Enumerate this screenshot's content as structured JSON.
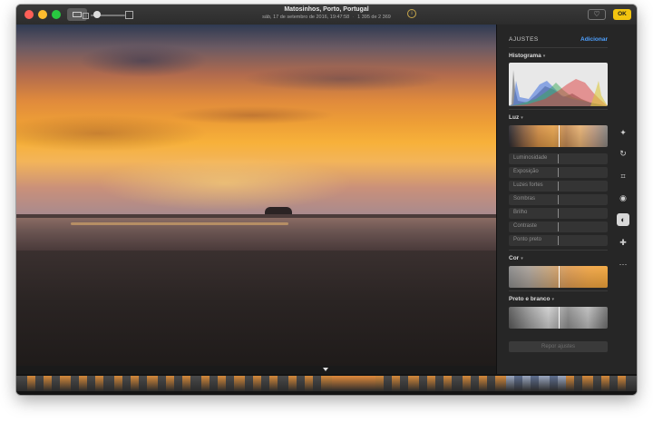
{
  "titlebar": {
    "title": "Matosinhos, Porto, Portugal",
    "date": "sáb, 17 de setembro de 2016, 19:47:58",
    "separator": "·",
    "count": "1 395 de 2 369",
    "info_icon": "info-icon",
    "favorite_icon": "heart-icon",
    "ok_label": "OK"
  },
  "panel": {
    "header": "AJUSTES",
    "add_label": "Adicionar",
    "histogram": {
      "title": "Histograma",
      "caret": "▾"
    },
    "light": {
      "title": "Luz",
      "caret": "▾",
      "sliders": [
        "Luminosidade",
        "Exposição",
        "Luzes fortes",
        "Sombras",
        "Brilho",
        "Contraste",
        "Ponto preto"
      ]
    },
    "color": {
      "title": "Cor",
      "caret": "▾"
    },
    "bw": {
      "title": "Preto e branco",
      "caret": "▾"
    },
    "reset_label": "Repor ajustes"
  },
  "tools": [
    {
      "name": "magic-wand-icon",
      "glyph": "✦"
    },
    {
      "name": "rotate-icon",
      "glyph": "↻"
    },
    {
      "name": "crop-icon",
      "glyph": "⌗"
    },
    {
      "name": "filters-icon",
      "glyph": "◉"
    },
    {
      "name": "adjust-icon",
      "glyph": "◐",
      "active": true
    },
    {
      "name": "retouch-icon",
      "glyph": "✚"
    },
    {
      "name": "more-icon",
      "glyph": "⋯"
    }
  ],
  "colors": {
    "accent": "#4ea0ff",
    "ok_button": "#f2c40f",
    "close": "#ff5f57",
    "minimize": "#febc2e",
    "maximize": "#28c840"
  }
}
